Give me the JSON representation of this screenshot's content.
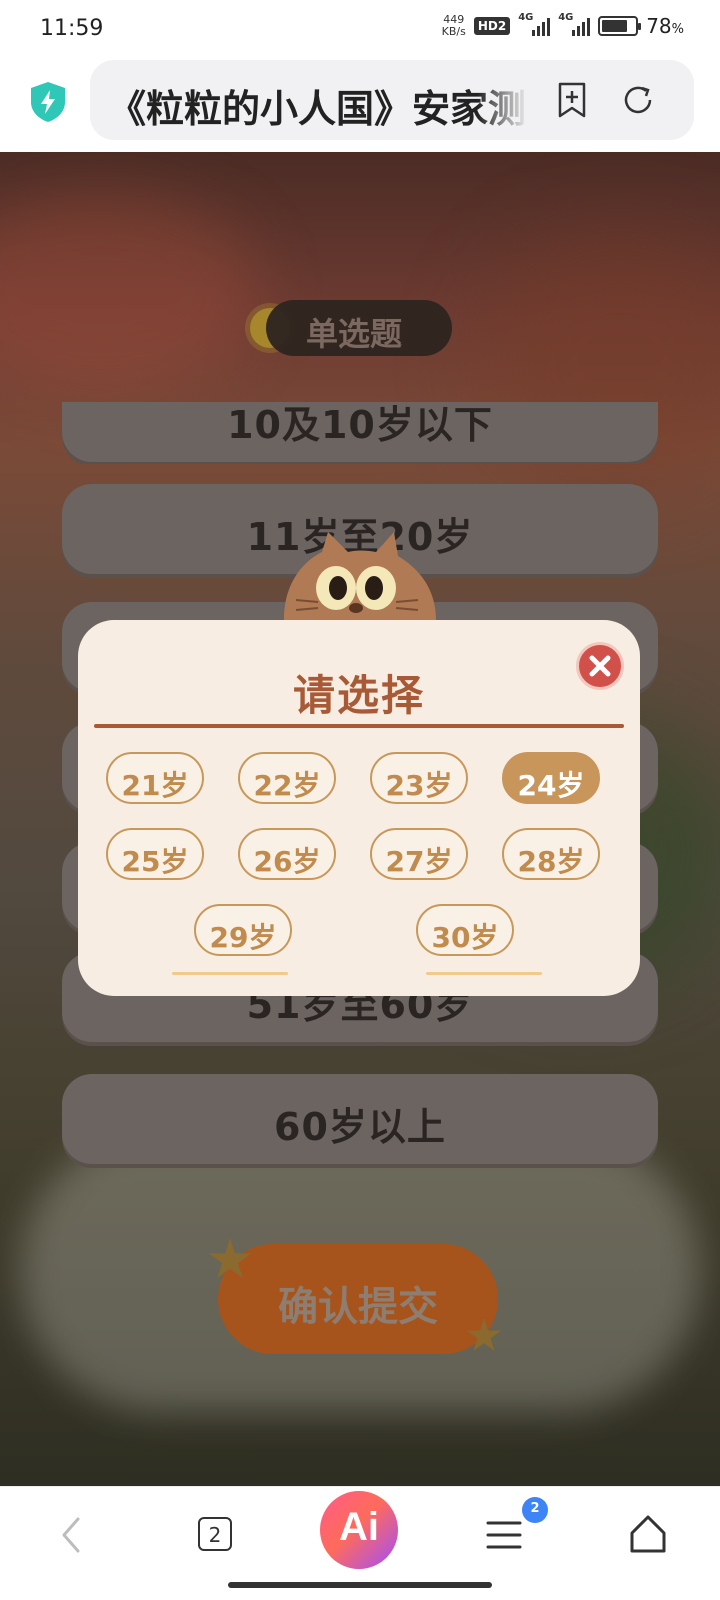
{
  "status_bar": {
    "time": "11:59",
    "net_speed_value": "449",
    "net_speed_unit": "KB/s",
    "hd_label": "HD2",
    "signal1_tag": "4G",
    "signal2_tag": "4G",
    "battery_level": 0.78,
    "battery_text": "78",
    "battery_unit": "%"
  },
  "address_bar": {
    "url_text": "《粒粒的小人国》安家测",
    "icons": [
      "shield-icon",
      "add-bookmark-icon",
      "refresh-icon"
    ],
    "shield_color": "#2fc7b6"
  },
  "page": {
    "question_type": "单选题",
    "options": [
      "10及10岁以下",
      "11岁至20岁",
      "51岁至60岁",
      "60岁以上"
    ],
    "submit_label": "确认提交"
  },
  "modal": {
    "title": "请选择",
    "selected": "24岁",
    "ages": [
      "21岁",
      "22岁",
      "23岁",
      "24岁",
      "25岁",
      "26岁",
      "27岁",
      "28岁",
      "29岁",
      "30岁"
    ],
    "accent_color": "#a85a37",
    "selected_color": "#c8955a"
  },
  "bottom_nav": {
    "tabs_count": "2",
    "ai_label": "Ai",
    "menu_badge": "2",
    "icons": [
      "back-icon",
      "tabs-icon",
      "ai-assistant-icon",
      "menu-icon",
      "home-icon"
    ]
  }
}
